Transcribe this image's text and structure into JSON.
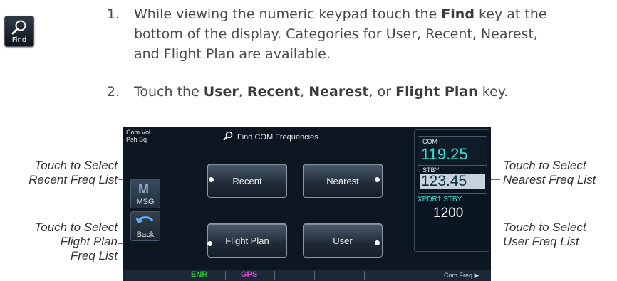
{
  "find_icon": {
    "label": "Find",
    "icon": "magnifier-icon"
  },
  "steps": [
    {
      "number": "1.",
      "line1_pre": "While viewing the numeric keypad touch the ",
      "line1_bold": "Find",
      "line1_post": " key at the",
      "line2": "bottom of the display. Categories for User, Recent, Nearest,",
      "line3": "and Flight Plan are available."
    },
    {
      "number": "2.",
      "pre": "Touch the ",
      "b1": "User",
      "s1": ", ",
      "b2": "Recent",
      "s2": ", ",
      "b3": "Nearest",
      "s3": ", or ",
      "b4": "Flight Plan",
      "post": " key."
    }
  ],
  "callouts": {
    "recent": [
      "Touch to Select",
      "Recent Freq List"
    ],
    "flight_plan": [
      "Touch to Select",
      "Flight Plan",
      "Freq List"
    ],
    "nearest": [
      "Touch to Select",
      "Nearest Freq List"
    ],
    "user": [
      "Touch to Select",
      "User Freq List"
    ]
  },
  "device": {
    "top_left": [
      "Com Vol",
      "Psh Sq"
    ],
    "title": "Find COM Frequencies",
    "keys": {
      "recent": "Recent",
      "nearest": "Nearest",
      "flight_plan": "Flight Plan",
      "user": "User"
    },
    "side": {
      "msg": "MSG",
      "back": "Back"
    },
    "freq": {
      "com_label": "COM",
      "active": "119.25",
      "stby_label": "STBY",
      "standby": "123.45",
      "xpdr_label": "XPDR1 STBY",
      "code": "1200"
    },
    "bottom_bar": {
      "enr": "ENR",
      "gps": "GPS",
      "right": "Com Freq ▶"
    }
  },
  "colors": {
    "accent_cyan": "#34e0d6",
    "enr_green": "#2fbf3a",
    "gps_magenta": "#d048c8"
  }
}
